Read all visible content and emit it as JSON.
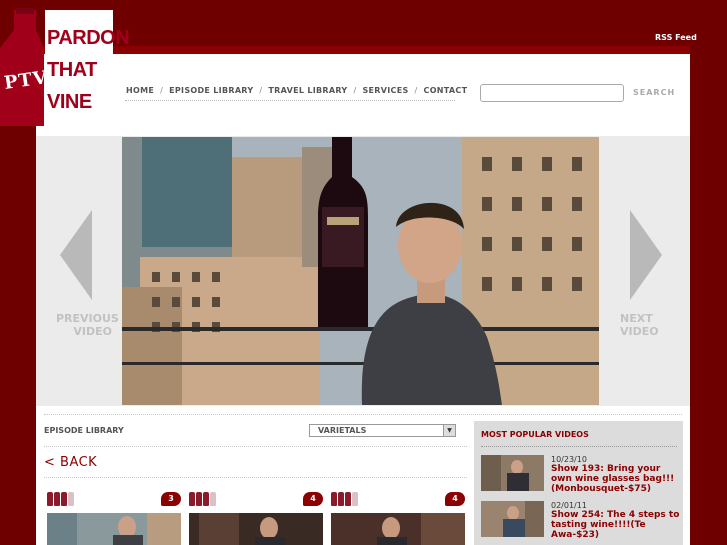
{
  "header": {
    "rss_label": "RSS Feed",
    "logo": {
      "line1": "PARDON",
      "line2": "THAT",
      "line3": "VINE",
      "monogram": "PTV"
    }
  },
  "nav": {
    "items": [
      {
        "label": "HOME"
      },
      {
        "label": "EPISODE LIBRARY"
      },
      {
        "label": "TRAVEL LIBRARY"
      },
      {
        "label": "SERVICES"
      },
      {
        "label": "CONTACT"
      }
    ],
    "separator": "/"
  },
  "search": {
    "value": "",
    "button_label": "SEARCH"
  },
  "video_nav": {
    "prev_line1": "PREVIOUS",
    "prev_line2": "VIDEO",
    "next_line1": "NEXT",
    "next_line2": "VIDEO"
  },
  "library": {
    "title": "EPISODE LIBRARY",
    "filter_selected": "VARIETALS",
    "back_label": "< BACK"
  },
  "cards": [
    {
      "badge": "3",
      "rating": 3
    },
    {
      "badge": "4",
      "rating": 3
    },
    {
      "badge": "4",
      "rating": 3
    }
  ],
  "popular": {
    "title": "MOST POPULAR VIDEOS",
    "items": [
      {
        "date": "10/23/10",
        "title": "Show 193: Bring your own wine glasses bag!!!(Monbousquet-$75)"
      },
      {
        "date": "02/01/11",
        "title": "Show 254: The 4 steps to tasting wine!!!!(Te Awa-$23)"
      }
    ]
  },
  "colors": {
    "background": "#6e0000",
    "accent": "#8b0000",
    "bottle_filled": "#8b1a2a",
    "bottle_empty": "#d9c2c6"
  }
}
